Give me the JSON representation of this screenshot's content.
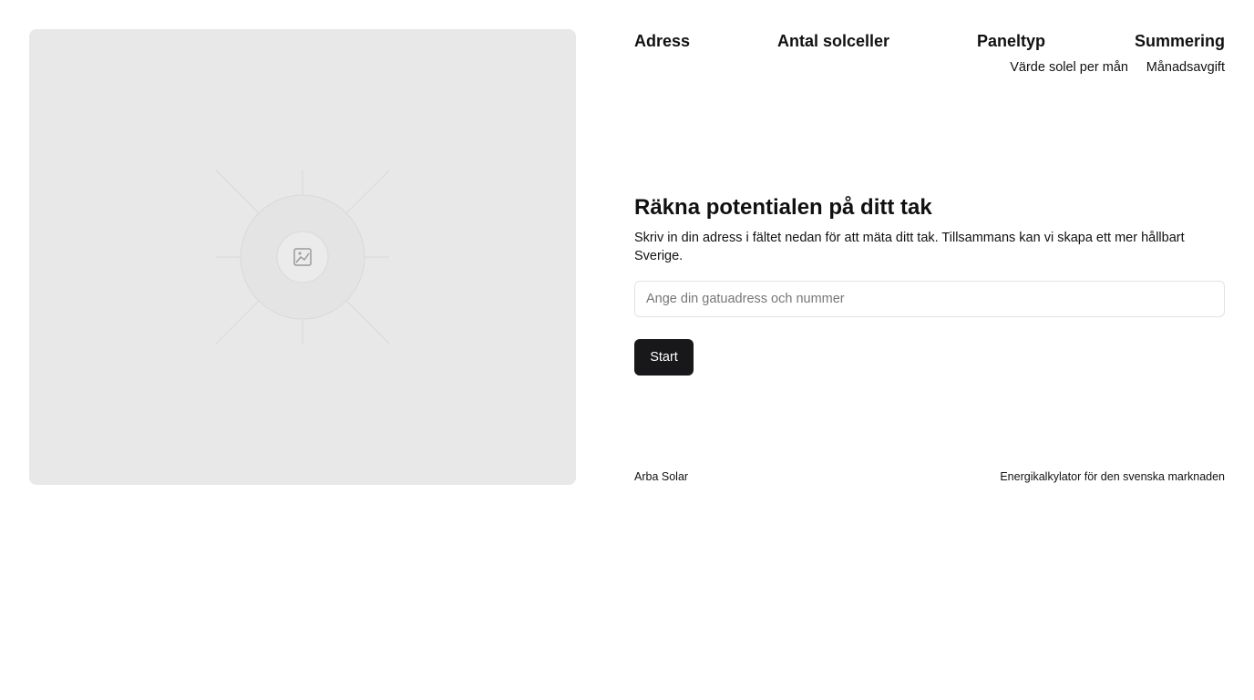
{
  "steps": {
    "adress": "Adress",
    "antal_solceller": "Antal solceller",
    "paneltyp": "Paneltyp",
    "summering": "Summering",
    "summering_items": [
      "Värde solel per mån",
      "Månadsavgift"
    ]
  },
  "hero": {
    "title": "Räkna potentialen på ditt tak",
    "description": "Skriv in din adress i fältet nedan för att mäta ditt tak. Tillsammans kan vi skapa ett mer hållbart Sverige."
  },
  "address_input": {
    "placeholder": "Ange din gatuadress och nummer",
    "value": ""
  },
  "start_button": {
    "label": "Start"
  },
  "footer": {
    "brand": "Arba Solar",
    "tagline": "Energikalkylator för den svenska marknaden"
  },
  "image_placeholder": {
    "icon": "image-icon"
  },
  "colors": {
    "panel_bg": "#e8e8e8",
    "button_bg": "#18181a",
    "button_text": "#ffffff",
    "input_border": "#e2e2e2",
    "text": "#111111"
  }
}
